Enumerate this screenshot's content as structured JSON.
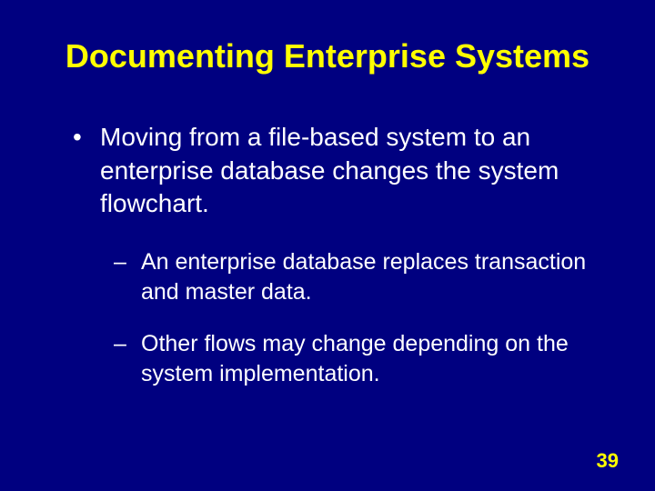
{
  "title": "Documenting Enterprise Systems",
  "bullet_main": "Moving from a file-based system to an enterprise database changes the system flowchart.",
  "sub_bullets": {
    "item0": "An enterprise database replaces transaction and master data.",
    "item1": "Other flows may change depending on the system implementation."
  },
  "page_number": "39"
}
